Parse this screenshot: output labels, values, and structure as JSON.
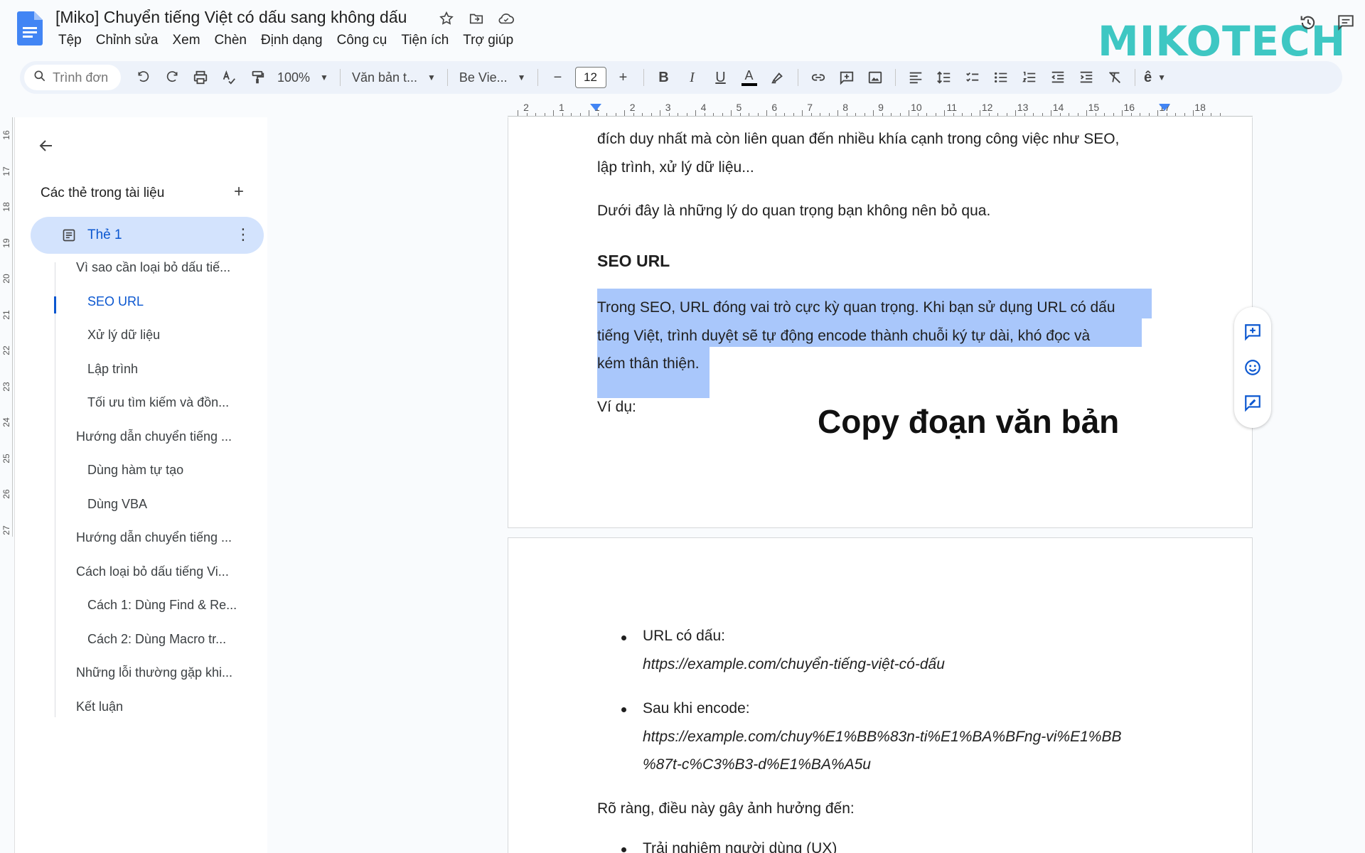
{
  "header": {
    "doc_title": "[Miko] Chuyển tiếng Việt có dấu sang không dấu",
    "menu": [
      "Tệp",
      "Chỉnh sửa",
      "Xem",
      "Chèn",
      "Định dạng",
      "Công cụ",
      "Tiện ích",
      "Trợ giúp"
    ],
    "brand": "MIKOTECH"
  },
  "toolbar": {
    "search_placeholder": "Trình đơn",
    "zoom": "100%",
    "style": "Văn bản t...",
    "font": "Be Vie...",
    "font_size": "12",
    "bold": "B",
    "italic": "I",
    "underline": "U",
    "text_color": "A"
  },
  "ruler": {
    "numbers": [
      "2",
      "1",
      "1",
      "2",
      "3",
      "4",
      "5",
      "6",
      "7",
      "8",
      "9",
      "10",
      "11",
      "12",
      "13",
      "14",
      "15",
      "16",
      "17",
      "18"
    ],
    "vertical": [
      "16",
      "17",
      "18",
      "19",
      "20",
      "21",
      "22",
      "23",
      "24",
      "25",
      "26",
      "27"
    ]
  },
  "outline": {
    "heading": "Các thẻ trong tài liệu",
    "active_tab": "Thẻ 1",
    "items": [
      {
        "label": "Vì sao cần loại bỏ dấu tiế...",
        "level": 1
      },
      {
        "label": "SEO URL",
        "level": 2,
        "active": true
      },
      {
        "label": "Xử lý dữ liệu",
        "level": 2
      },
      {
        "label": "Lập trình",
        "level": 2
      },
      {
        "label": "Tối ưu tìm kiếm và đồn...",
        "level": 2
      },
      {
        "label": "Hướng dẫn chuyển tiếng ...",
        "level": 1
      },
      {
        "label": "Dùng hàm tự tạo",
        "level": 2
      },
      {
        "label": "Dùng VBA",
        "level": 2
      },
      {
        "label": "Hướng dẫn chuyển tiếng ...",
        "level": 1
      },
      {
        "label": "Cách loại bỏ dấu tiếng Vi...",
        "level": 1
      },
      {
        "label": "Cách 1: Dùng Find & Re...",
        "level": 2
      },
      {
        "label": "Cách 2: Dùng Macro tr...",
        "level": 2
      },
      {
        "label": "Những lỗi thường gặp khi...",
        "level": 1
      },
      {
        "label": "Kết luận",
        "level": 1
      }
    ]
  },
  "document": {
    "p1_line1": "đích duy nhất mà còn liên quan đến nhiều khía cạnh trong công việc như SEO,",
    "p1_line2": "lập trình, xử lý dữ liệu...",
    "p2": "Dưới đây là những lý do quan trọng bạn không nên bỏ qua.",
    "heading_seo": "SEO URL",
    "sel_line1": "Trong SEO, URL đóng vai trò cực kỳ quan trọng. Khi bạn sử dụng URL có dấu",
    "sel_line2": "tiếng Việt, trình duyệt sẽ tự động encode thành chuỗi ký tự dài, khó đọc và",
    "sel_line3": "kém thân thiện.",
    "example": "Ví dụ:",
    "b1_label": "URL có dấu:",
    "b1_url": "https://example.com/chuyển-tiếng-việt-có-dấu",
    "b2_label": "Sau khi encode:",
    "b2_url1": "https://example.com/chuy%E1%BB%83n-ti%E1%BA%BFng-vi%E1%BB",
    "b2_url2": "%87t-c%C3%B3-d%E1%BA%A5u",
    "p3": "Rõ ràng, điều này gây ảnh hưởng đến:",
    "b3_partial": "Trải nghiệm người dùng (UX)"
  },
  "overlay_caption": "Copy đoạn văn bản",
  "colors": {
    "accent": "#0b57d0",
    "selection": "#a9c7fb",
    "active_tab_bg": "#d3e3fd",
    "brand": "#3ec7c3"
  }
}
